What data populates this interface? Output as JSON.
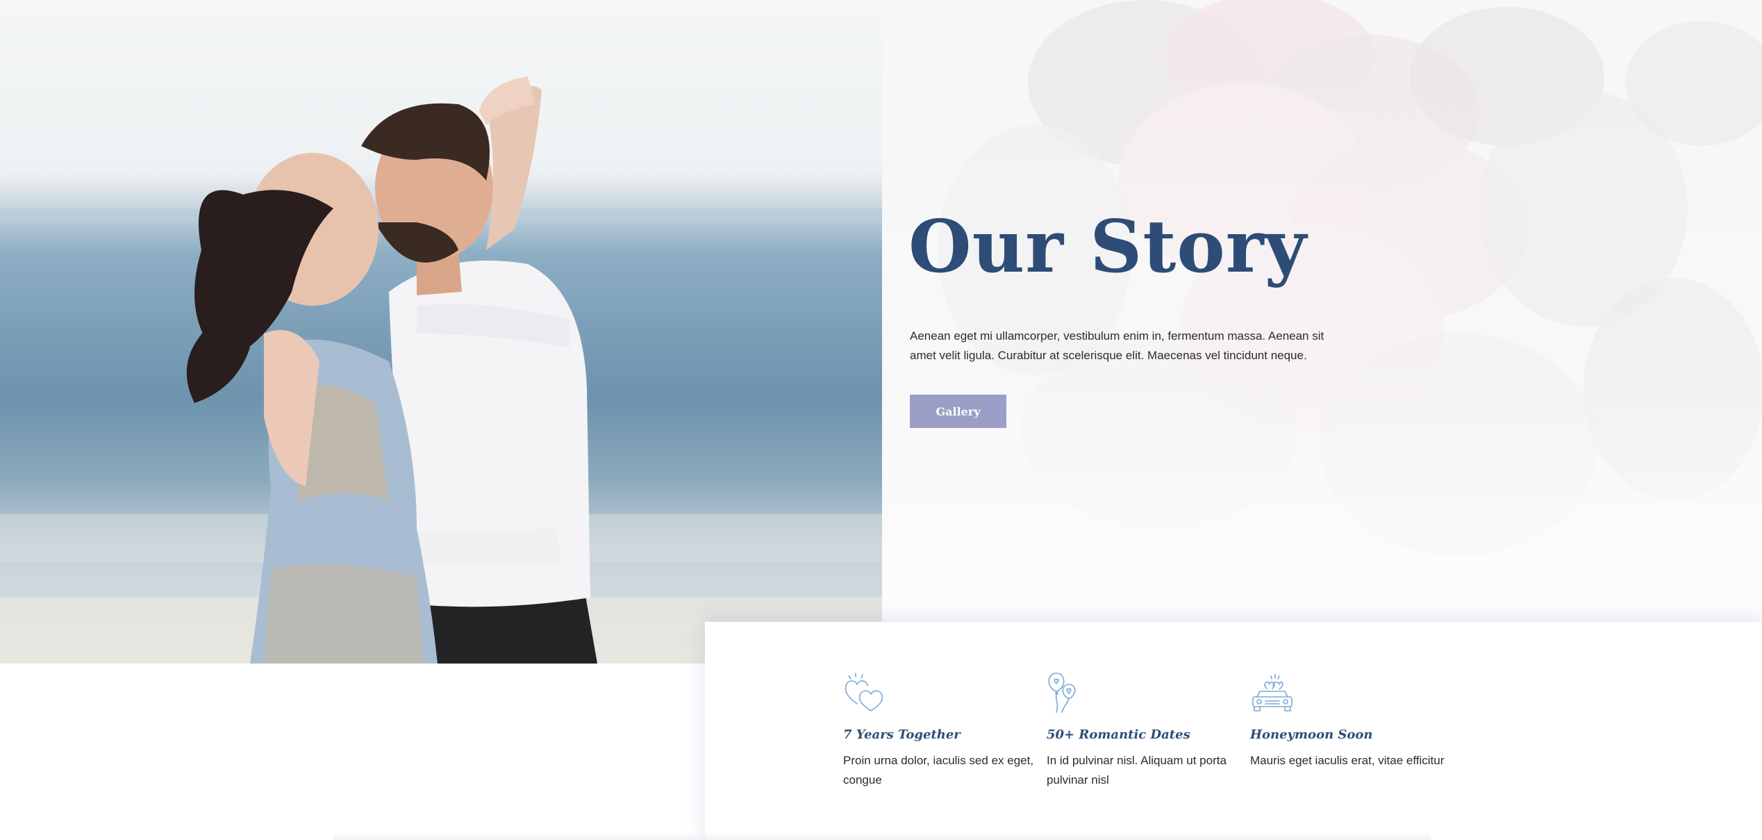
{
  "hero": {
    "title": "Our Story",
    "description": "Aenean eget mi ullamcorper, vestibulum enim in, fermentum massa. Aenean sit amet velit ligula. Curabitur at scelerisque elit. Maecenas vel tincidunt neque.",
    "button_label": "Gallery"
  },
  "features": [
    {
      "icon": "hearts-icon",
      "title": "7 Years Together",
      "text": "Proin urna dolor, iaculis sed ex eget, congue"
    },
    {
      "icon": "balloons-icon",
      "title": "50+ Romantic Dates",
      "text": "In id pulvinar nisl. Aliquam ut porta pulvinar nisl"
    },
    {
      "icon": "wedding-car-icon",
      "title": "Honeymoon Soon",
      "text": "Mauris eget iaculis erat, vitae efficitur"
    }
  ],
  "colors": {
    "heading": "#2d4d77",
    "button": "#9b9ec6",
    "icon_stroke": "#7aa8d8",
    "body_text": "#2a2a33"
  }
}
